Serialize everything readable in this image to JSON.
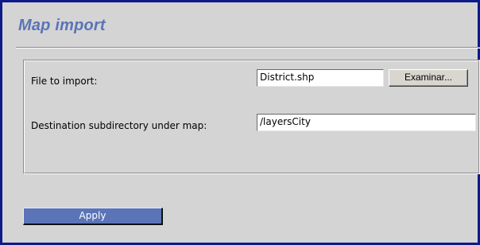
{
  "header": {
    "title": "Map import"
  },
  "form": {
    "file_label": "File to import:",
    "file_value": "District.shp",
    "browse_label": "Examinar...",
    "destination_label": "Destination subdirectory under map:",
    "destination_value": "/layersCity"
  },
  "actions": {
    "apply_label": "Apply"
  },
  "colors": {
    "frame_border": "#0c1a8a",
    "title": "#5b74b8",
    "apply_button": "#5b74b8",
    "background": "#d4d4d4"
  }
}
